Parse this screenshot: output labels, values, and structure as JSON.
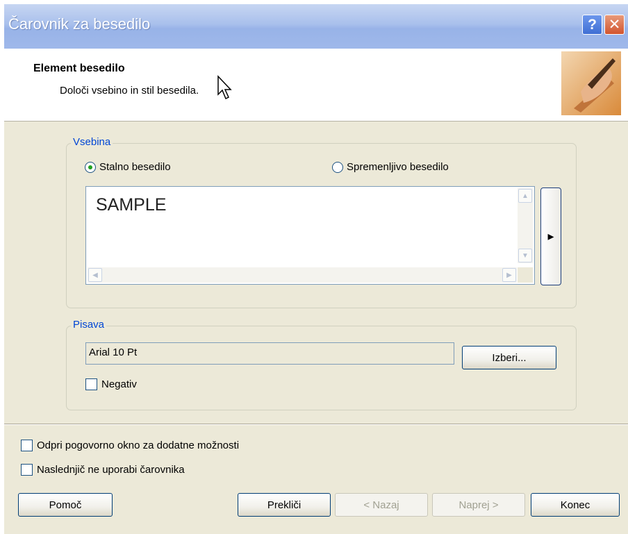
{
  "window": {
    "title": "Čarovnik za besedilo",
    "help_label": "?",
    "close_label": "✕"
  },
  "header": {
    "title": "Element besedilo",
    "subtitle": "Določi vsebino in stil besedila."
  },
  "content_group": {
    "label": "Vsebina",
    "radio_fixed": {
      "label": "Stalno besedilo",
      "checked": true
    },
    "radio_variable": {
      "label": "Spremenljivo besedilo",
      "checked": false
    },
    "text_value": "SAMPLE",
    "insert_button_label": "▸"
  },
  "font_group": {
    "label": "Pisava",
    "font_value": "Arial 10 Pt",
    "select_button_label": "Izberi...",
    "negative": {
      "label": "Negativ",
      "checked": false
    }
  },
  "options": {
    "open_dialog": {
      "label": "Odpri pogovorno okno za dodatne možnosti",
      "checked": false
    },
    "dont_use_wizard": {
      "label": "Naslednjič ne uporabi čarovnika",
      "checked": false
    }
  },
  "footer": {
    "help_label": "Pomoč",
    "cancel_label": "Prekliči",
    "back_label": "< Nazaj",
    "next_label": "Naprej >",
    "finish_label": "Konec"
  },
  "colors": {
    "group_label": "#0046d5",
    "dialog_bg": "#ece9d8",
    "button_border": "#003c74"
  }
}
